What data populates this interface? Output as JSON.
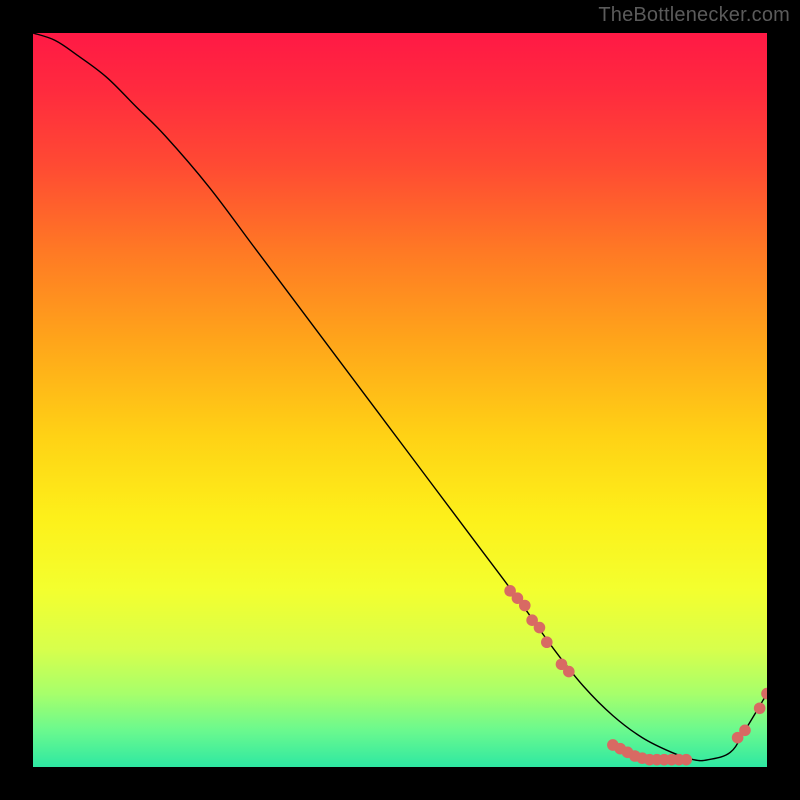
{
  "watermark": "TheBottlenecker.com",
  "chart_data": {
    "type": "line",
    "title": "",
    "xlabel": "",
    "ylabel": "",
    "xlim": [
      0,
      100
    ],
    "ylim": [
      0,
      100
    ],
    "background": {
      "type": "vertical-gradient",
      "stops": [
        {
          "offset": 0.0,
          "color": "#ff1945"
        },
        {
          "offset": 0.08,
          "color": "#ff2b3e"
        },
        {
          "offset": 0.18,
          "color": "#ff4a33"
        },
        {
          "offset": 0.3,
          "color": "#ff7a24"
        },
        {
          "offset": 0.42,
          "color": "#ffa51a"
        },
        {
          "offset": 0.55,
          "color": "#ffd215"
        },
        {
          "offset": 0.66,
          "color": "#fdf01a"
        },
        {
          "offset": 0.76,
          "color": "#f3ff2f"
        },
        {
          "offset": 0.84,
          "color": "#d7ff4c"
        },
        {
          "offset": 0.9,
          "color": "#a7ff6b"
        },
        {
          "offset": 0.95,
          "color": "#6bf98e"
        },
        {
          "offset": 1.0,
          "color": "#2ee8a2"
        }
      ]
    },
    "series": [
      {
        "name": "bottleneck-curve",
        "color": "#000000",
        "stroke_width": 1.4,
        "x": [
          0,
          3,
          6,
          10,
          14,
          18,
          24,
          30,
          36,
          42,
          48,
          54,
          60,
          66,
          71,
          75,
          79,
          83,
          87,
          90,
          92,
          95,
          97,
          100
        ],
        "y": [
          100,
          99,
          97,
          94,
          90,
          86,
          79,
          71,
          63,
          55,
          47,
          39,
          31,
          23,
          16,
          11,
          7,
          4,
          2,
          1,
          1,
          2,
          5,
          10
        ]
      }
    ],
    "markers": [
      {
        "name": "highlight-dots",
        "color": "#d86a63",
        "radius": 5.8,
        "points": [
          {
            "x": 65,
            "y": 24
          },
          {
            "x": 66,
            "y": 23
          },
          {
            "x": 67,
            "y": 22
          },
          {
            "x": 68,
            "y": 20
          },
          {
            "x": 69,
            "y": 19
          },
          {
            "x": 70,
            "y": 17
          },
          {
            "x": 72,
            "y": 14
          },
          {
            "x": 73,
            "y": 13
          },
          {
            "x": 79,
            "y": 3
          },
          {
            "x": 80,
            "y": 2.5
          },
          {
            "x": 81,
            "y": 2
          },
          {
            "x": 82,
            "y": 1.5
          },
          {
            "x": 83,
            "y": 1.2
          },
          {
            "x": 84,
            "y": 1
          },
          {
            "x": 85,
            "y": 1
          },
          {
            "x": 86,
            "y": 1
          },
          {
            "x": 87,
            "y": 1
          },
          {
            "x": 88,
            "y": 1
          },
          {
            "x": 89,
            "y": 1
          },
          {
            "x": 96,
            "y": 4
          },
          {
            "x": 97,
            "y": 5
          },
          {
            "x": 99,
            "y": 8
          },
          {
            "x": 100,
            "y": 10
          }
        ]
      }
    ]
  }
}
